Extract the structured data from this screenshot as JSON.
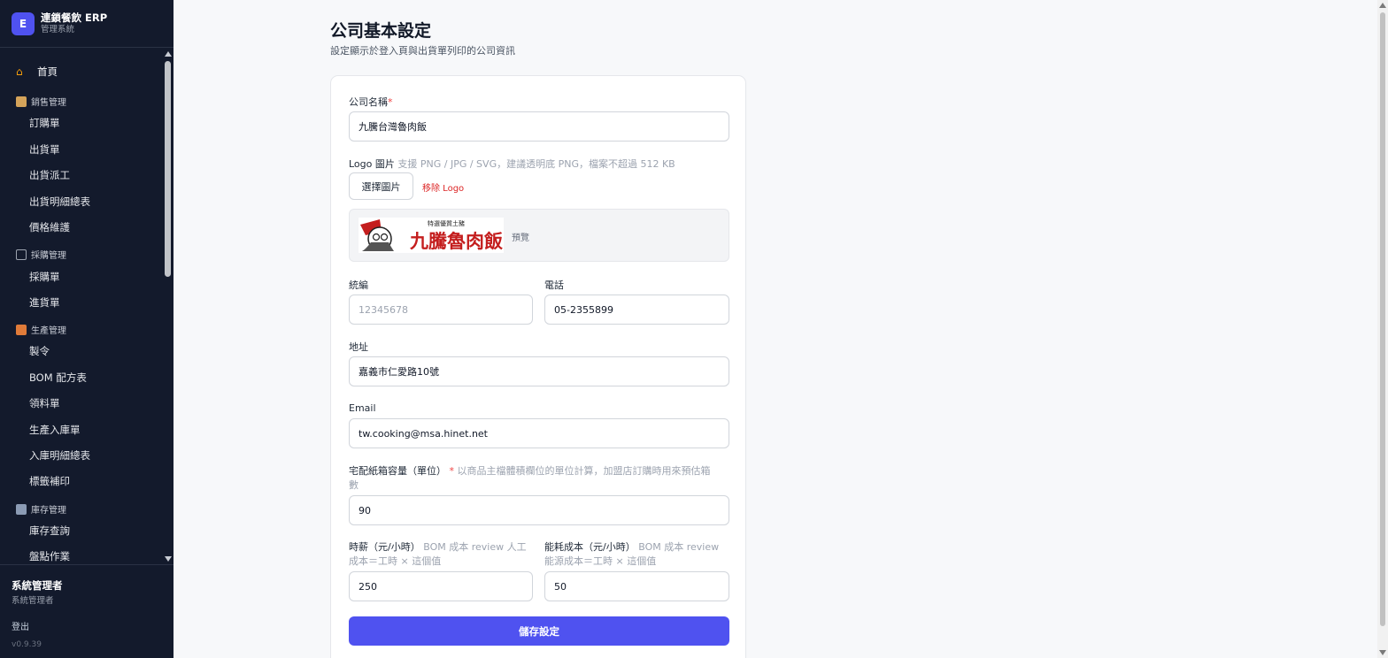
{
  "sidebar": {
    "brand_initial": "E",
    "brand_title": "連鎖餐飲 ERP",
    "brand_subtitle": "管理系統",
    "home_label": "首頁",
    "groups": [
      {
        "label": "銷售管理",
        "items": [
          "訂購單",
          "出貨單",
          "出貨派工",
          "出貨明細總表",
          "價格維護"
        ]
      },
      {
        "label": "採購管理",
        "items": [
          "採購單",
          "進貨單"
        ]
      },
      {
        "label": "生產管理",
        "items": [
          "製令",
          "BOM 配方表",
          "領料單",
          "生產入庫單",
          "入庫明細總表",
          "標籤補印"
        ]
      },
      {
        "label": "庫存管理",
        "items": [
          "庫存查詢",
          "盤點作業"
        ]
      }
    ],
    "user_name": "系統管理者",
    "user_role": "系統管理者",
    "logout_label": "登出",
    "version": "v0.9.39"
  },
  "page": {
    "title": "公司基本設定",
    "subtitle": "設定顯示於登入頁與出貨單列印的公司資訊"
  },
  "form": {
    "company_name_label": "公司名稱",
    "required_mark": "*",
    "company_name_value": "九騰台灣魯肉飯",
    "logo_label": "Logo 圖片",
    "logo_hint": "支援 PNG / JPG / SVG，建議透明底 PNG，檔案不超過 512 KB",
    "choose_image_label": "選擇圖片",
    "remove_logo_label": "移除 Logo",
    "logo_text": "九騰魯肉飯",
    "logo_tagline": "特選優質土豬",
    "preview_label": "預覽",
    "tax_id_label": "統編",
    "tax_id_placeholder": "12345678",
    "phone_label": "電話",
    "phone_value": "05-2355899",
    "address_label": "地址",
    "address_value": "嘉義市仁愛路10號",
    "email_label": "Email",
    "email_value": "tw.cooking@msa.hinet.net",
    "box_capacity_label": "宅配紙箱容量（單位）",
    "box_capacity_hint": "以商品主檔體積欄位的單位計算，加盟店訂購時用來預估箱",
    "box_capacity_hint2": "數",
    "box_capacity_value": "90",
    "hourly_wage_label": "時薪（元/小時）",
    "hourly_wage_hint": "BOM 成本 review 人工",
    "hourly_wage_hint2": "成本＝工時 × 這個值",
    "hourly_wage_value": "250",
    "energy_cost_label": "能耗成本（元/小時）",
    "energy_cost_hint": "BOM 成本 review",
    "energy_cost_hint2": "能源成本＝工時 × 這個值",
    "energy_cost_value": "50",
    "save_label": "儲存設定"
  },
  "colors": {
    "sidebar_bg": "#131a2c",
    "accent": "#4f52f0",
    "danger": "#dc2626"
  }
}
